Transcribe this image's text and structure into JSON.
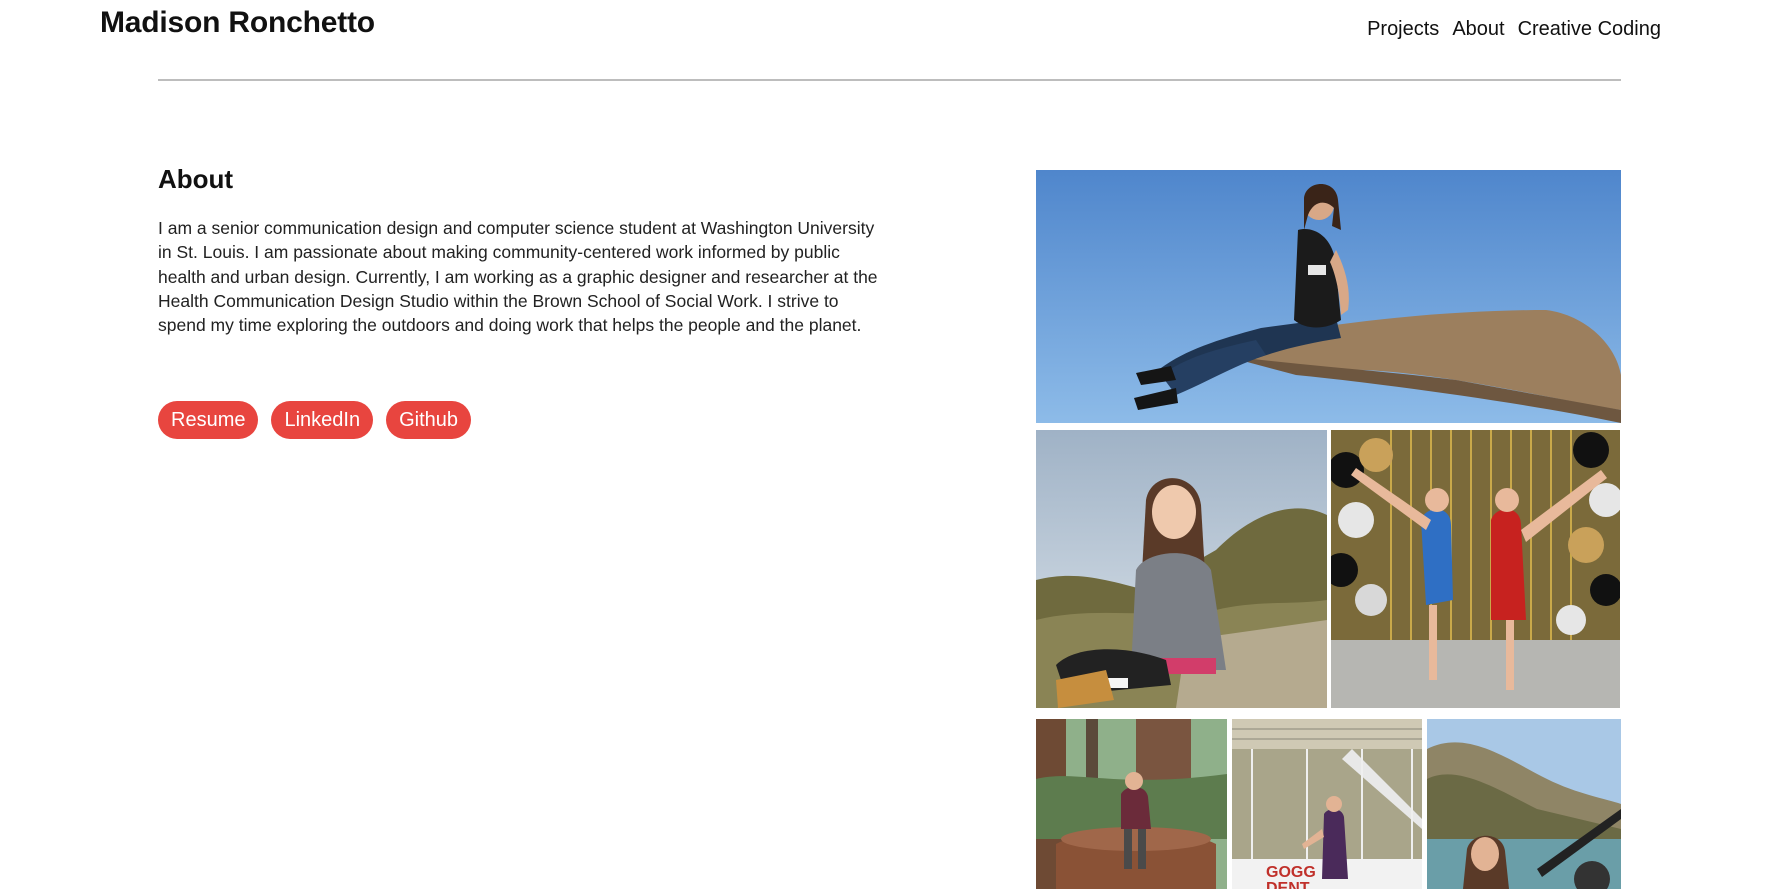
{
  "header": {
    "site_name": "Madison Ronchetto",
    "nav": [
      "Projects",
      "About",
      "Creative Coding"
    ]
  },
  "about": {
    "title": "About",
    "bio": "I am a senior communication design and computer science student at Washington University in St. Louis. I am passionate about making community-centered work informed by public health and urban design. Currently, I am working as a graphic designer and researcher at the Health Communication Design Studio within the Brown School of Social Work. I strive to spend my time exploring the outdoors and doing work that helps the people and the planet.",
    "buttons": [
      "Resume",
      "LinkedIn",
      "Github"
    ]
  },
  "gallery": {
    "rink_sign": "GOGG\nDENT"
  },
  "colors": {
    "accent": "#e8453f",
    "divider": "#bdbdbd",
    "sky": "#5a8fd0"
  }
}
